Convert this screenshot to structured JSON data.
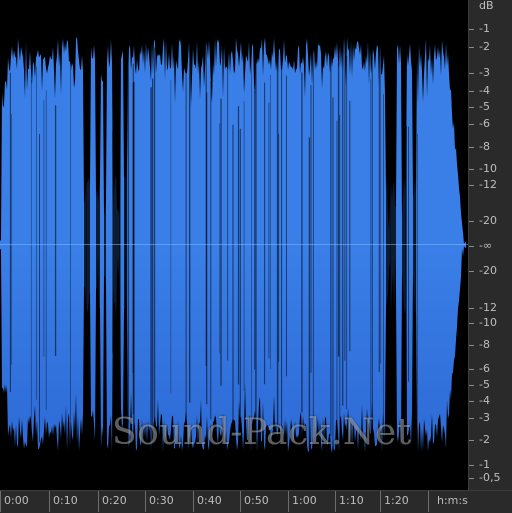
{
  "colors": {
    "waveform": "#3a7fe8",
    "waveform_dark": "#2d6ad6",
    "background": "#000000",
    "ruler_background": "#2a2a2a",
    "ruler_text": "#bdbdbd"
  },
  "db_ruler": {
    "unit": "dB",
    "labels": [
      "-1",
      "-2",
      "-3",
      "-4",
      "-5",
      "-6",
      "-8",
      "-10",
      "-12",
      "-20",
      "-∞",
      "-20",
      "-12",
      "-10",
      "-8",
      "-6",
      "-5",
      "-4",
      "-3",
      "-2",
      "-1",
      "-0,5"
    ]
  },
  "time_ruler": {
    "unit": "h:m:s",
    "labels": [
      "0:00",
      "0:10",
      "0:20",
      "0:30",
      "0:40",
      "0:50",
      "1:00",
      "1:10",
      "1:20"
    ]
  },
  "watermark": {
    "text": "Sound-Pack.Net"
  }
}
